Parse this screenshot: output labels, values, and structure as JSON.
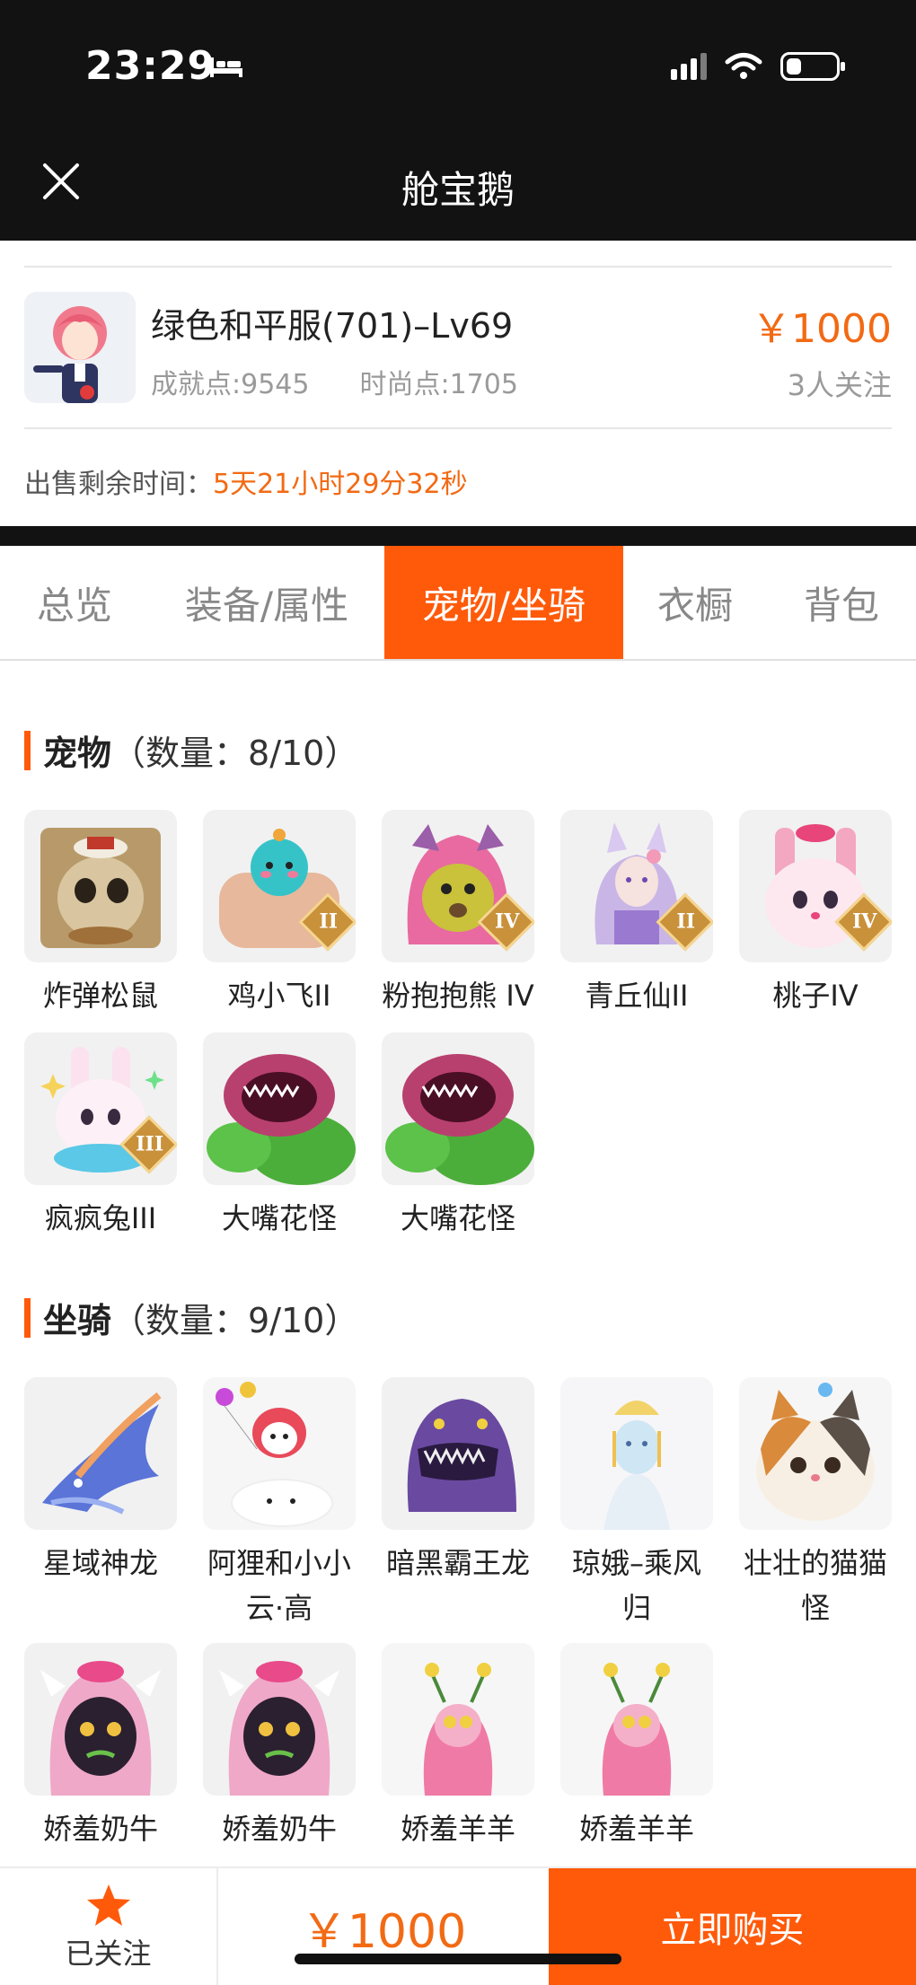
{
  "status_bar": {
    "time": "23:29"
  },
  "nav": {
    "title": "舱宝鹅"
  },
  "listing": {
    "name": "绿色和平服(701)–Lv69",
    "achievement": "成就点:9545",
    "fashion": "时尚点:1705",
    "price": "￥1000",
    "followers": "3人关注",
    "remain_label": "出售剩余时间：",
    "remain_value": "5天21小时29分32秒"
  },
  "tabs": [
    "总览",
    "装备/属性",
    "宠物/坐骑",
    "衣橱",
    "背包"
  ],
  "active_tab": "宠物/坐骑",
  "pets": {
    "title": "宠物",
    "count": "（数量：8/10）",
    "items": [
      {
        "label": "炸弹松鼠",
        "badge": ""
      },
      {
        "label": "鸡小飞II",
        "badge": "II"
      },
      {
        "label": "粉抱抱熊 IV",
        "badge": "IV"
      },
      {
        "label": "青丘仙II",
        "badge": "II"
      },
      {
        "label": "桃子IV",
        "badge": "IV"
      },
      {
        "label": "疯疯兔III",
        "badge": "III"
      },
      {
        "label": "大嘴花怪",
        "badge": ""
      },
      {
        "label": "大嘴花怪",
        "badge": ""
      }
    ]
  },
  "mounts": {
    "title": "坐骑",
    "count": "（数量：9/10）",
    "items": [
      {
        "label": "星域神龙"
      },
      {
        "label": "阿狸和小小云·高"
      },
      {
        "label": "暗黑霸王龙"
      },
      {
        "label": "琼娥–乘风归"
      },
      {
        "label": "壮壮的猫猫怪"
      },
      {
        "label": "娇羞奶牛"
      },
      {
        "label": "娇羞奶牛"
      },
      {
        "label": "娇羞羊羊"
      },
      {
        "label": "娇羞羊羊"
      }
    ]
  },
  "bottom": {
    "follow_label": "已关注",
    "price": "￥1000",
    "buy_label": "立即购买"
  },
  "colors": {
    "accent": "#ff5a0a",
    "price": "#f26a14",
    "dark": "#121212"
  },
  "icons": [
    "bed-icon",
    "signal-icon",
    "wifi-icon",
    "battery-icon",
    "close-icon",
    "star-icon"
  ]
}
